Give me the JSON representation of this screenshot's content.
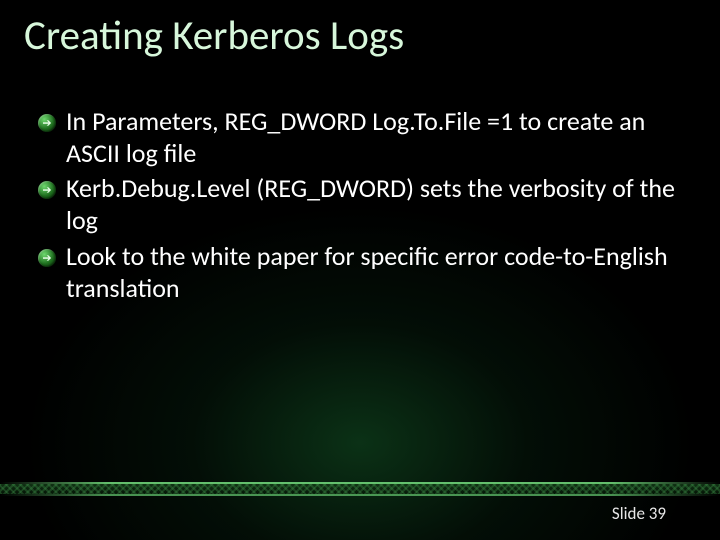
{
  "title": "Creating Kerberos Logs",
  "bullets": [
    "In Parameters, REG_DWORD Log.To.File =1 to create an ASCII log file",
    "Kerb.Debug.Level (REG_DWORD) sets the verbosity of the log",
    "Look to the white paper for specific error code-to-English translation"
  ],
  "footer": {
    "slide_label": "Slide 39"
  }
}
